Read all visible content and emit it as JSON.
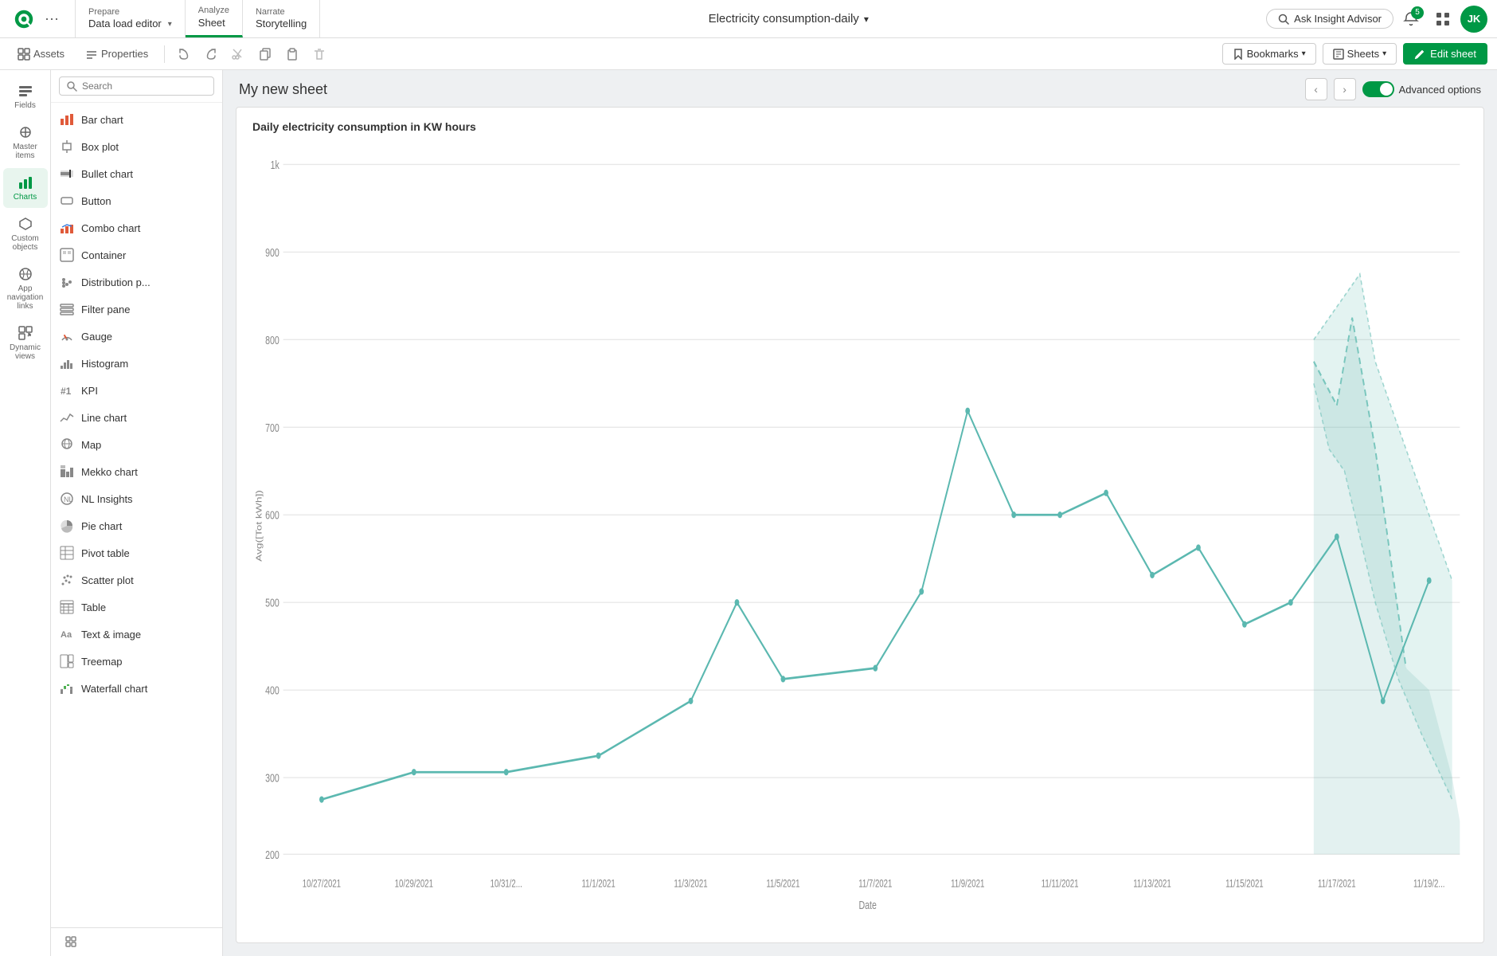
{
  "app_title": "Electricity consumption-daily",
  "nav": {
    "prepare_sub": "Prepare",
    "prepare_title": "Data load editor",
    "analyze_sub": "Analyze",
    "analyze_title": "Sheet",
    "narrate_sub": "Narrate",
    "narrate_title": "Storytelling",
    "insight_advisor": "Ask Insight Advisor",
    "notification_count": "5",
    "user_initials": "JK"
  },
  "toolbar": {
    "assets_label": "Assets",
    "properties_label": "Properties",
    "bookmarks_label": "Bookmarks",
    "sheets_label": "Sheets",
    "edit_sheet_label": "Edit sheet"
  },
  "sidebar": {
    "items": [
      {
        "id": "fields",
        "label": "Fields"
      },
      {
        "id": "master-items",
        "label": "Master items"
      },
      {
        "id": "charts",
        "label": "Charts"
      },
      {
        "id": "custom-objects",
        "label": "Custom objects"
      },
      {
        "id": "app-navigation",
        "label": "App navigation links"
      },
      {
        "id": "dynamic-views",
        "label": "Dynamic views"
      }
    ]
  },
  "charts_panel": {
    "search_placeholder": "Search",
    "items": [
      {
        "id": "bar-chart",
        "label": "Bar chart",
        "icon": "bar"
      },
      {
        "id": "box-plot",
        "label": "Box plot",
        "icon": "box"
      },
      {
        "id": "bullet-chart",
        "label": "Bullet chart",
        "icon": "bullet"
      },
      {
        "id": "button",
        "label": "Button",
        "icon": "button"
      },
      {
        "id": "combo-chart",
        "label": "Combo chart",
        "icon": "combo"
      },
      {
        "id": "container",
        "label": "Container",
        "icon": "container"
      },
      {
        "id": "distribution-plot",
        "label": "Distribution p...",
        "icon": "dist"
      },
      {
        "id": "filter-pane",
        "label": "Filter pane",
        "icon": "filter"
      },
      {
        "id": "gauge",
        "label": "Gauge",
        "icon": "gauge"
      },
      {
        "id": "histogram",
        "label": "Histogram",
        "icon": "histogram"
      },
      {
        "id": "kpi",
        "label": "KPI",
        "icon": "kpi"
      },
      {
        "id": "line-chart",
        "label": "Line chart",
        "icon": "line"
      },
      {
        "id": "map",
        "label": "Map",
        "icon": "map"
      },
      {
        "id": "mekko-chart",
        "label": "Mekko chart",
        "icon": "mekko"
      },
      {
        "id": "nl-insights",
        "label": "NL Insights",
        "icon": "nl"
      },
      {
        "id": "pie-chart",
        "label": "Pie chart",
        "icon": "pie"
      },
      {
        "id": "pivot-table",
        "label": "Pivot table",
        "icon": "pivot"
      },
      {
        "id": "scatter-plot",
        "label": "Scatter plot",
        "icon": "scatter"
      },
      {
        "id": "table",
        "label": "Table",
        "icon": "table"
      },
      {
        "id": "text-image",
        "label": "Text & image",
        "icon": "text"
      },
      {
        "id": "treemap",
        "label": "Treemap",
        "icon": "treemap"
      },
      {
        "id": "waterfall-chart",
        "label": "Waterfall chart",
        "icon": "waterfall"
      }
    ]
  },
  "sheet": {
    "title": "My new sheet",
    "chart_title": "Daily electricity consumption in KW hours",
    "y_axis_label": "Avg([Tot kWh])",
    "x_axis_label": "Date",
    "advanced_options_label": "Advanced options",
    "y_ticks": [
      "1k",
      "900",
      "800",
      "700",
      "600",
      "500",
      "400",
      "300",
      "200"
    ],
    "x_ticks": [
      "10/27/2021",
      "10/29/2021",
      "10/31/2...",
      "11/1/2021",
      "11/3/2021",
      "11/5/2021",
      "11/7/2021",
      "11/9/2021",
      "11/11/2021",
      "11/13/2021",
      "11/15/2021",
      "11/17/2021",
      "11/19/2..."
    ]
  }
}
